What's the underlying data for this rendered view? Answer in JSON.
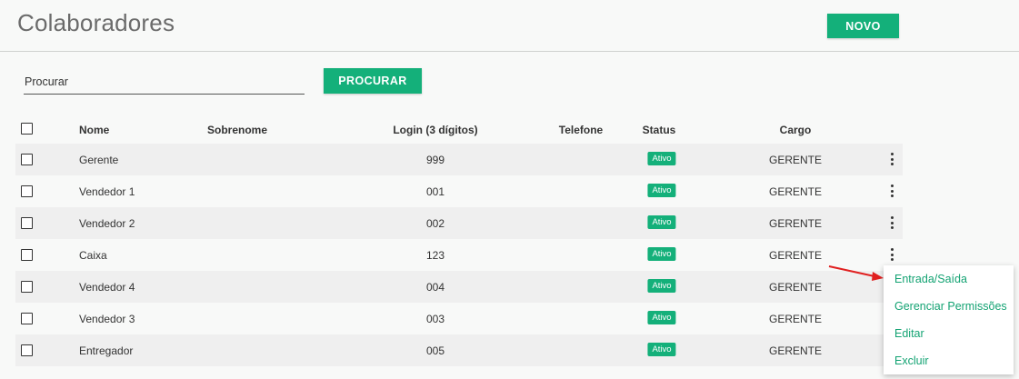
{
  "header": {
    "title": "Colaboradores",
    "new_button": "NOVO"
  },
  "search": {
    "placeholder": "Procurar",
    "button": "PROCURAR"
  },
  "table": {
    "columns": [
      "Nome",
      "Sobrenome",
      "Login (3 dígitos)",
      "Telefone",
      "Status",
      "Cargo"
    ],
    "rows": [
      {
        "nome": "Gerente",
        "sobrenome": "",
        "login": "999",
        "telefone": "",
        "status": "Ativo",
        "cargo": "GERENTE"
      },
      {
        "nome": "Vendedor 1",
        "sobrenome": "",
        "login": "001",
        "telefone": "",
        "status": "Ativo",
        "cargo": "GERENTE"
      },
      {
        "nome": "Vendedor 2",
        "sobrenome": "",
        "login": "002",
        "telefone": "",
        "status": "Ativo",
        "cargo": "GERENTE"
      },
      {
        "nome": "Caixa",
        "sobrenome": "",
        "login": "123",
        "telefone": "",
        "status": "Ativo",
        "cargo": "GERENTE"
      },
      {
        "nome": "Vendedor 4",
        "sobrenome": "",
        "login": "004",
        "telefone": "",
        "status": "Ativo",
        "cargo": "GERENTE"
      },
      {
        "nome": "Vendedor 3",
        "sobrenome": "",
        "login": "003",
        "telefone": "",
        "status": "Ativo",
        "cargo": "GERENTE"
      },
      {
        "nome": "Entregador",
        "sobrenome": "",
        "login": "005",
        "telefone": "",
        "status": "Ativo",
        "cargo": "GERENTE"
      }
    ]
  },
  "context_menu": {
    "items": [
      "Entrada/Saída",
      "Gerenciar Permissões",
      "Editar",
      "Excluir"
    ]
  },
  "colors": {
    "accent": "#14b07a",
    "menu_text": "#14a373",
    "annotation_arrow": "#e02020"
  },
  "icons": {
    "row_actions": "more-vert-icon",
    "annotation": "red-arrow-icon"
  }
}
